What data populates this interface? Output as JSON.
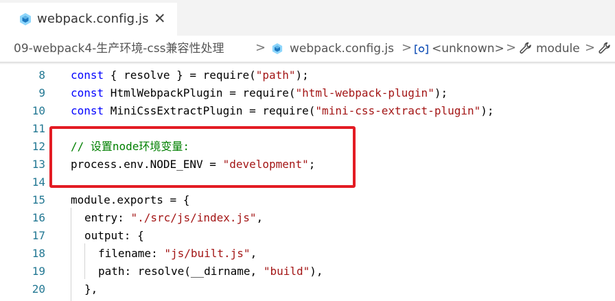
{
  "tab": {
    "title": "webpack.config.js",
    "icon": "webpack-icon",
    "close": "✕"
  },
  "breadcrumb": {
    "folder": "09-webpack4-生产环境-css兼容性处理",
    "file": "webpack.config.js",
    "symbol1": "<unknown>",
    "symbol2": "module",
    "separator": ">"
  },
  "editor": {
    "lines": [
      {
        "num": "8"
      },
      {
        "num": "9"
      },
      {
        "num": "10"
      },
      {
        "num": "11"
      },
      {
        "num": "12"
      },
      {
        "num": "13"
      },
      {
        "num": "14"
      },
      {
        "num": "15"
      },
      {
        "num": "16"
      },
      {
        "num": "17"
      },
      {
        "num": "18"
      },
      {
        "num": "19"
      },
      {
        "num": "20"
      }
    ],
    "code": {
      "l8": {
        "kw": "const",
        "a": " { resolve } = require(",
        "s": "\"path\"",
        "b": ");"
      },
      "l9": {
        "kw": "const",
        "a": " HtmlWebpackPlugin = require(",
        "s": "\"html-webpack-plugin\"",
        "b": ");"
      },
      "l10": {
        "kw": "const",
        "a": " MiniCssExtractPlugin = require(",
        "s": "\"mini-css-extract-plugin\"",
        "b": ");"
      },
      "l12": {
        "comment": "// 设置node环境变量:"
      },
      "l13": {
        "a": "process.env.NODE_ENV = ",
        "s": "\"development\"",
        "b": ";"
      },
      "l15": {
        "a": "module.exports = {"
      },
      "l16": {
        "a": "entry: ",
        "s": "\"./src/js/index.js\"",
        "b": ","
      },
      "l17": {
        "a": "output: {"
      },
      "l18": {
        "a": "filename: ",
        "s": "\"js/built.js\"",
        "b": ","
      },
      "l19": {
        "a": "path: resolve(__dirname, ",
        "s": "\"build\"",
        "b": "),"
      },
      "l20": {
        "a": "},"
      }
    }
  },
  "colors": {
    "keyword": "#0000ff",
    "string": "#a31515",
    "comment": "#008000",
    "line_number": "#237893",
    "highlight_border": "#e31b23"
  }
}
